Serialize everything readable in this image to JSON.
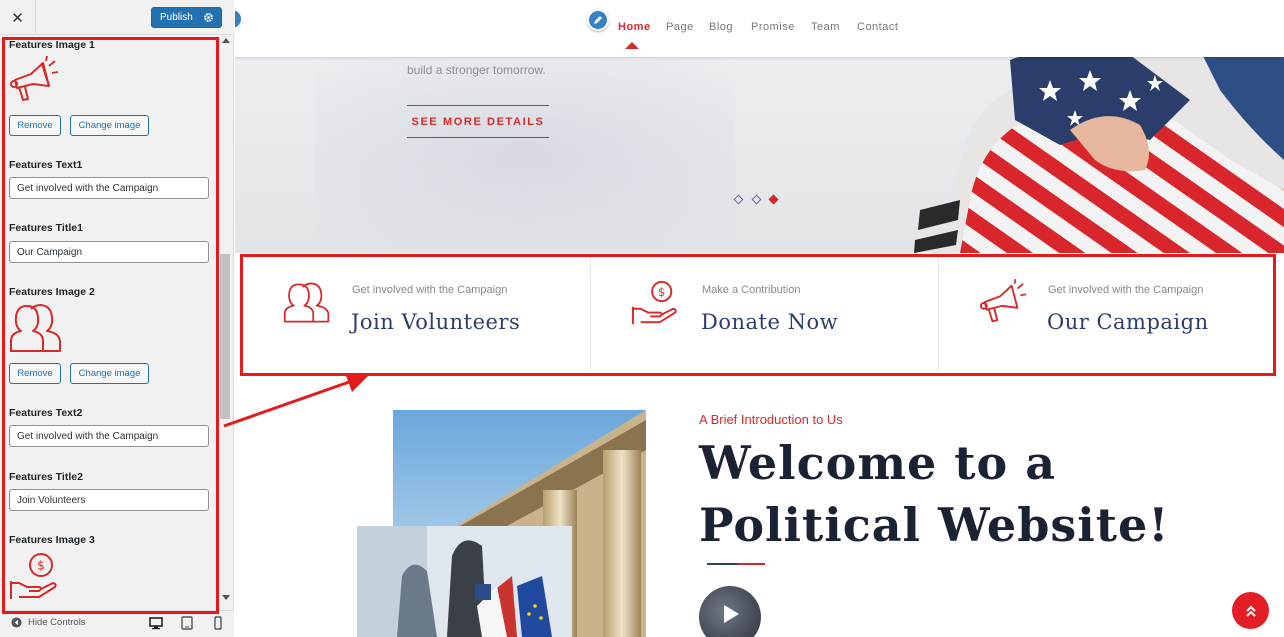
{
  "sidebar": {
    "close_label": "✕",
    "publish_label": "Publish",
    "fields": {
      "features_image_1": "Features Image 1",
      "features_text_1": "Features Text1",
      "features_text_1_value": "Get involved with the Campaign",
      "features_title_1": "Features Title1",
      "features_title_1_value": "Our Campaign",
      "features_image_2": "Features Image 2",
      "features_text_2": "Features Text2",
      "features_text_2_value": "Get involved with the Campaign",
      "features_title_2": "Features Title2",
      "features_title_2_value": "Join Volunteers",
      "features_image_3": "Features Image 3"
    },
    "remove_label": "Remove",
    "change_image_label": "Change image",
    "hide_controls_label": "Hide Controls"
  },
  "preview": {
    "nav": {
      "items": [
        "Home",
        "Page",
        "Blog",
        "Promise",
        "Team",
        "Contact"
      ]
    },
    "hero": {
      "subtitle": "build a stronger tomorrow.",
      "cta": "SEE MORE DETAILS"
    },
    "features": [
      {
        "text": "Get involved with the Campaign",
        "title": "Join Volunteers",
        "icon": "volunteers-icon"
      },
      {
        "text": "Make a Contribution",
        "title": "Donate Now",
        "icon": "donate-hand-icon"
      },
      {
        "text": "Get involved with the Campaign",
        "title": "Our Campaign",
        "icon": "megaphone-icon"
      }
    ],
    "intro": {
      "kicker": "A Brief Introduction to Us",
      "heading": "Welcome to a Political Website!"
    }
  },
  "colors": {
    "accent_red": "#d62a2a",
    "navy": "#2c3e6b",
    "wp_blue": "#2271b1",
    "annotation_red": "#e41b1b"
  }
}
